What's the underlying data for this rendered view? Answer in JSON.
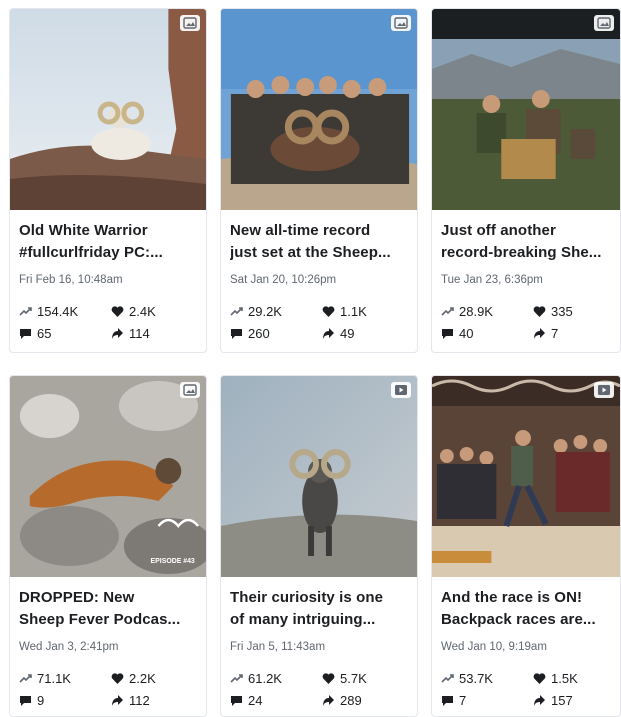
{
  "posts": [
    {
      "title_lines": [
        "Old White Warrior",
        "#fullcurlfriday PC:..."
      ],
      "date": "Fri Feb 16, 10:48am",
      "reach": "154.4K",
      "likes": "2.4K",
      "comments": "65",
      "shares": "114",
      "media_icon": "image-icon"
    },
    {
      "title_lines": [
        "New all-time record",
        "just set at the Sheep..."
      ],
      "date": "Sat Jan 20, 10:26pm",
      "reach": "29.2K",
      "likes": "1.1K",
      "comments": "260",
      "shares": "49",
      "media_icon": "image-icon"
    },
    {
      "title_lines": [
        "Just off another",
        "record-breaking She..."
      ],
      "date": "Tue Jan 23, 6:36pm",
      "reach": "28.9K",
      "likes": "335",
      "comments": "40",
      "shares": "7",
      "media_icon": "image-icon"
    },
    {
      "title_lines": [
        "DROPPED: New",
        "Sheep Fever Podcas..."
      ],
      "date": "Wed Jan 3, 2:41pm",
      "reach": "71.1K",
      "likes": "2.2K",
      "comments": "9",
      "shares": "112",
      "media_icon": "image-icon",
      "overlay_text": "EPISODE #43"
    },
    {
      "title_lines": [
        "Their curiosity is one",
        "of many intriguing..."
      ],
      "date": "Fri Jan 5, 11:43am",
      "reach": "61.2K",
      "likes": "5.7K",
      "comments": "24",
      "shares": "289",
      "media_icon": "video-icon"
    },
    {
      "title_lines": [
        "And the race is ON!",
        "Backpack races are..."
      ],
      "date": "Wed Jan 10, 9:19am",
      "reach": "53.7K",
      "likes": "1.5K",
      "comments": "7",
      "shares": "157",
      "media_icon": "video-icon"
    }
  ]
}
